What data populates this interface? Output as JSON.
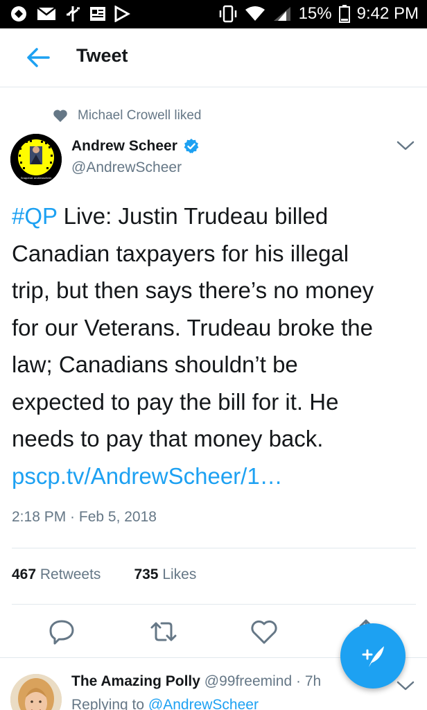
{
  "status_bar": {
    "battery": "15%",
    "time": "9:42 PM",
    "icons": [
      "sync-icon",
      "mail-icon",
      "usb-icon",
      "news-icon",
      "play-store-icon",
      "vibrate-icon",
      "wifi-icon",
      "signal-icon",
      "battery-icon"
    ]
  },
  "header": {
    "title": "Tweet",
    "back_icon": "back-arrow-icon"
  },
  "social_context": {
    "text": "Michael Crowell liked",
    "icon": "heart-filled-icon"
  },
  "tweet": {
    "author_name": "Andrew Scheer",
    "verified_icon": "verified-badge-icon",
    "author_handle": "@AndrewScheer",
    "avatar_caption": "Snapchat: andrewscheer",
    "hashtag": "#QP",
    "text_lines": [
      " Live: Justin Trudeau billed",
      "Canadian taxpayers for his illegal",
      "trip, but then says there’s no money",
      "for our Veterans. Trudeau broke the",
      "law; Canadians shouldn’t be",
      "expected to pay the bill for it. He",
      "needs to pay that money back."
    ],
    "link": "pscp.tv/AndrewScheer/1…",
    "timestamp": "2:18 PM · Feb 5, 2018",
    "retweets_count": "467",
    "retweets_label": "Retweets",
    "likes_count": "735",
    "likes_label": "Likes"
  },
  "actions": [
    "reply-icon",
    "retweet-icon",
    "like-icon",
    "share-icon"
  ],
  "fab_icon": "compose-tweet-icon",
  "reply": {
    "name": "The Amazing Polly",
    "handle": "@99freemind",
    "separator": " · ",
    "time": "7h",
    "replying_prefix": "Replying to ",
    "replying_handle": "@AndrewScheer"
  },
  "colors": {
    "accent": "#1da1f2",
    "text": "#14171a",
    "secondary": "#657786",
    "divider": "#e1e8ed"
  }
}
